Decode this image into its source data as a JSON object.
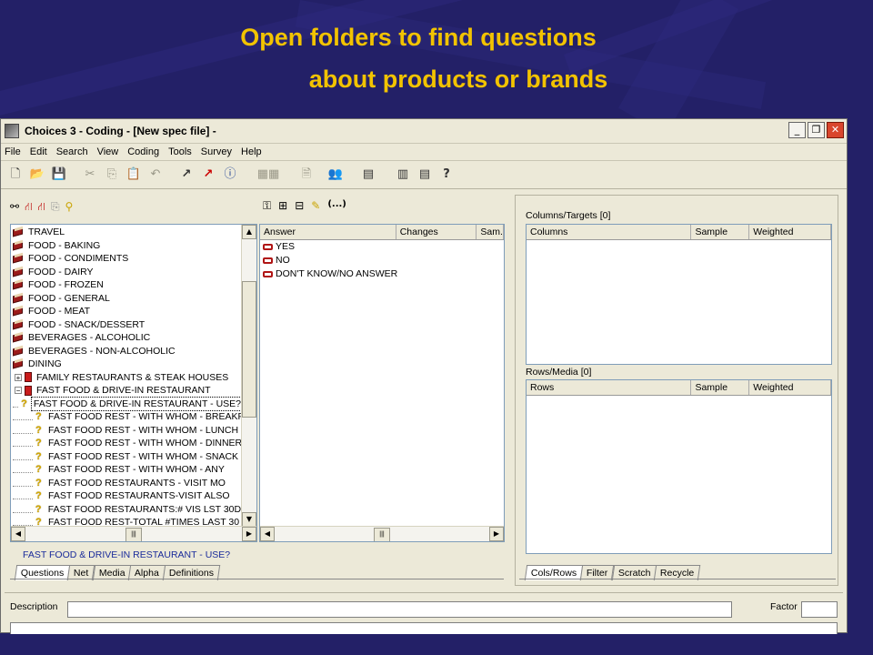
{
  "slide": {
    "title_line1": "Open folders to find questions",
    "title_line2": "about products or brands"
  },
  "window": {
    "title": "Choices 3 - Coding - [New spec file] -",
    "controls": {
      "minimize": "_",
      "restore": "❐",
      "close": "✕"
    }
  },
  "menu": [
    "File",
    "Edit",
    "Search",
    "View",
    "Coding",
    "Tools",
    "Survey",
    "Help"
  ],
  "toolbar_icons": [
    "new-file-icon",
    "open-folder-icon",
    "save-icon",
    "cut-icon",
    "copy-icon",
    "paste-icon",
    "undo-icon",
    "spec-s-icon",
    "spec-s-red-icon",
    "info-icon",
    "table-grid-icon",
    "document-icon",
    "people-icon",
    "chart-edit-icon",
    "layout-left-icon",
    "layout-split-icon",
    "help-icon"
  ],
  "tree": {
    "items": [
      {
        "label": "TRAVEL",
        "type": "book"
      },
      {
        "label": "FOOD - BAKING",
        "type": "book"
      },
      {
        "label": "FOOD - CONDIMENTS",
        "type": "book"
      },
      {
        "label": "FOOD - DAIRY",
        "type": "book"
      },
      {
        "label": "FOOD - FROZEN",
        "type": "book"
      },
      {
        "label": "FOOD - GENERAL",
        "type": "book"
      },
      {
        "label": "FOOD - MEAT",
        "type": "book"
      },
      {
        "label": "FOOD - SNACK/DESSERT",
        "type": "book"
      },
      {
        "label": "BEVERAGES - ALCOHOLIC",
        "type": "book"
      },
      {
        "label": "BEVERAGES - NON-ALCOHOLIC",
        "type": "book"
      },
      {
        "label": "DINING",
        "type": "book"
      },
      {
        "label": "FAMILY RESTAURANTS & STEAK HOUSES",
        "type": "folder-collapsed"
      },
      {
        "label": "FAST FOOD & DRIVE-IN RESTAURANT",
        "type": "folder-expanded"
      },
      {
        "label": "FAST FOOD & DRIVE-IN RESTAURANT - USE?",
        "type": "question-selected"
      },
      {
        "label": "FAST FOOD REST - WITH WHOM -  BREAKF",
        "type": "question"
      },
      {
        "label": "FAST FOOD REST - WITH WHOM - LUNCH",
        "type": "question"
      },
      {
        "label": "FAST FOOD REST - WITH WHOM -  DINNER",
        "type": "question"
      },
      {
        "label": "FAST FOOD REST - WITH WHOM - SNACK",
        "type": "question"
      },
      {
        "label": "FAST FOOD REST - WITH WHOM - ANY",
        "type": "question"
      },
      {
        "label": "FAST FOOD RESTAURANTS - VISIT MO",
        "type": "question"
      },
      {
        "label": "FAST FOOD RESTAURANTS-VISIT ALSO",
        "type": "question"
      },
      {
        "label": "FAST FOOD RESTAURANTS:# VIS LST 30D/",
        "type": "question"
      },
      {
        "label": "FAST FOOD REST-TOTAL #TIMES LAST 30",
        "type": "question"
      }
    ],
    "status_text": "FAST FOOD & DRIVE-IN RESTAURANT - USE?",
    "tabs": [
      "Questions",
      "Net",
      "Media",
      "Alpha",
      "Definitions"
    ]
  },
  "answers": {
    "headers": [
      "Answer",
      "Changes",
      "Sam."
    ],
    "rows": [
      "YES",
      "NO",
      "DON'T KNOW/NO ANSWER"
    ],
    "toolbar_text": "(...)"
  },
  "right_panel": {
    "columns_label": "Columns/Targets [0]",
    "columns_headers": [
      "Columns",
      "Sample",
      "Weighted"
    ],
    "rows_label": "Rows/Media [0]",
    "rows_headers": [
      "Rows",
      "Sample",
      "Weighted"
    ],
    "tabs": [
      "Cols/Rows",
      "Filter",
      "Scratch",
      "Recycle"
    ]
  },
  "bottom": {
    "description_label": "Description",
    "factor_label": "Factor"
  }
}
